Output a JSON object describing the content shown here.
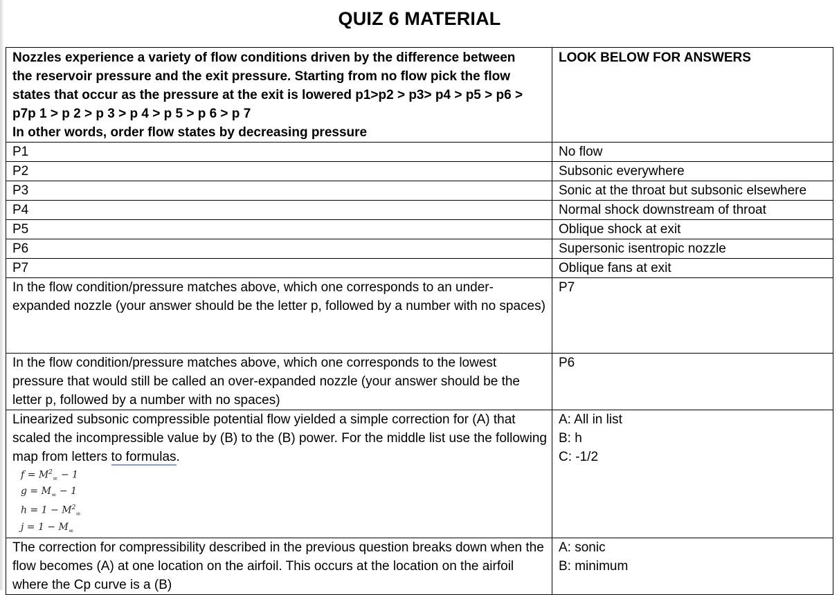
{
  "title": "QUIZ 6 MATERIAL",
  "q1": {
    "prompt_lines": [
      "Nozzles experience a variety of flow conditions driven by the difference between",
      "the reservoir pressure and the exit pressure. Starting from no flow pick the flow",
      "states that occur as the pressure at the exit is lowered p1>p2 > p3> p4 > p5 > p6 >",
      "p7p 1 > p 2 > p 3 > p 4 > p 5 > p 6 > p 7",
      "In other words, order flow states by decreasing pressure"
    ],
    "header_answer": "LOOK BELOW FOR ANSWERS",
    "rows": [
      {
        "p": "P1",
        "state": "No flow"
      },
      {
        "p": "P2",
        "state": "Subsonic everywhere"
      },
      {
        "p": "P3",
        "state": "Sonic at the throat but subsonic elsewhere"
      },
      {
        "p": "P4",
        "state": "Normal shock downstream of throat"
      },
      {
        "p": "P5",
        "state": "Oblique shock at exit"
      },
      {
        "p": "P6",
        "state": "Supersonic isentropic nozzle"
      },
      {
        "p": "P7",
        "state": "Oblique fans at exit"
      }
    ]
  },
  "q2": {
    "prompt": "In the flow condition/pressure matches above, which one corresponds to an under-expanded nozzle (your answer should be the letter p, followed by a number with no spaces)",
    "answer": "P7"
  },
  "q3": {
    "prompt": "In the flow condition/pressure matches above, which one corresponds to the lowest pressure that would still be called an over-expanded nozzle (your answer should be the letter p, followed by a number with no spaces)",
    "answer": "P6"
  },
  "q4": {
    "prompt_before": "Linearized subsonic compressible potential flow yielded a simple correction for (A) that scaled the incompressible value by (B) to the (B) power.  For the middle list use the following map from letters ",
    "prompt_underlined": "to  formulas",
    "prompt_after": ".",
    "formulas": [
      {
        "lhs": "f",
        "rhs": "M",
        "sub": "∞",
        "sup": "2",
        "op": " − 1",
        "pre": ""
      },
      {
        "lhs": "g",
        "rhs": "M",
        "sub": "∞",
        "sup": "",
        "op": " − 1",
        "pre": ""
      },
      {
        "lhs": "h",
        "rhs": "M",
        "sub": "∞",
        "sup": "2",
        "op": "",
        "pre": "1 − "
      },
      {
        "lhs": "j",
        "rhs": "M",
        "sub": "∞",
        "sup": "",
        "op": "",
        "pre": "1 − "
      }
    ],
    "answers": [
      "A: All in list",
      "B: h",
      "C: -1/2"
    ]
  },
  "q5": {
    "prompt": "The correction for compressibility described in the previous question breaks down when the flow becomes (A) at one location on the airfoil. This occurs at the location on the airfoil where the Cp curve is a (B)",
    "answers": [
      "A: sonic",
      "B: minimum"
    ]
  }
}
